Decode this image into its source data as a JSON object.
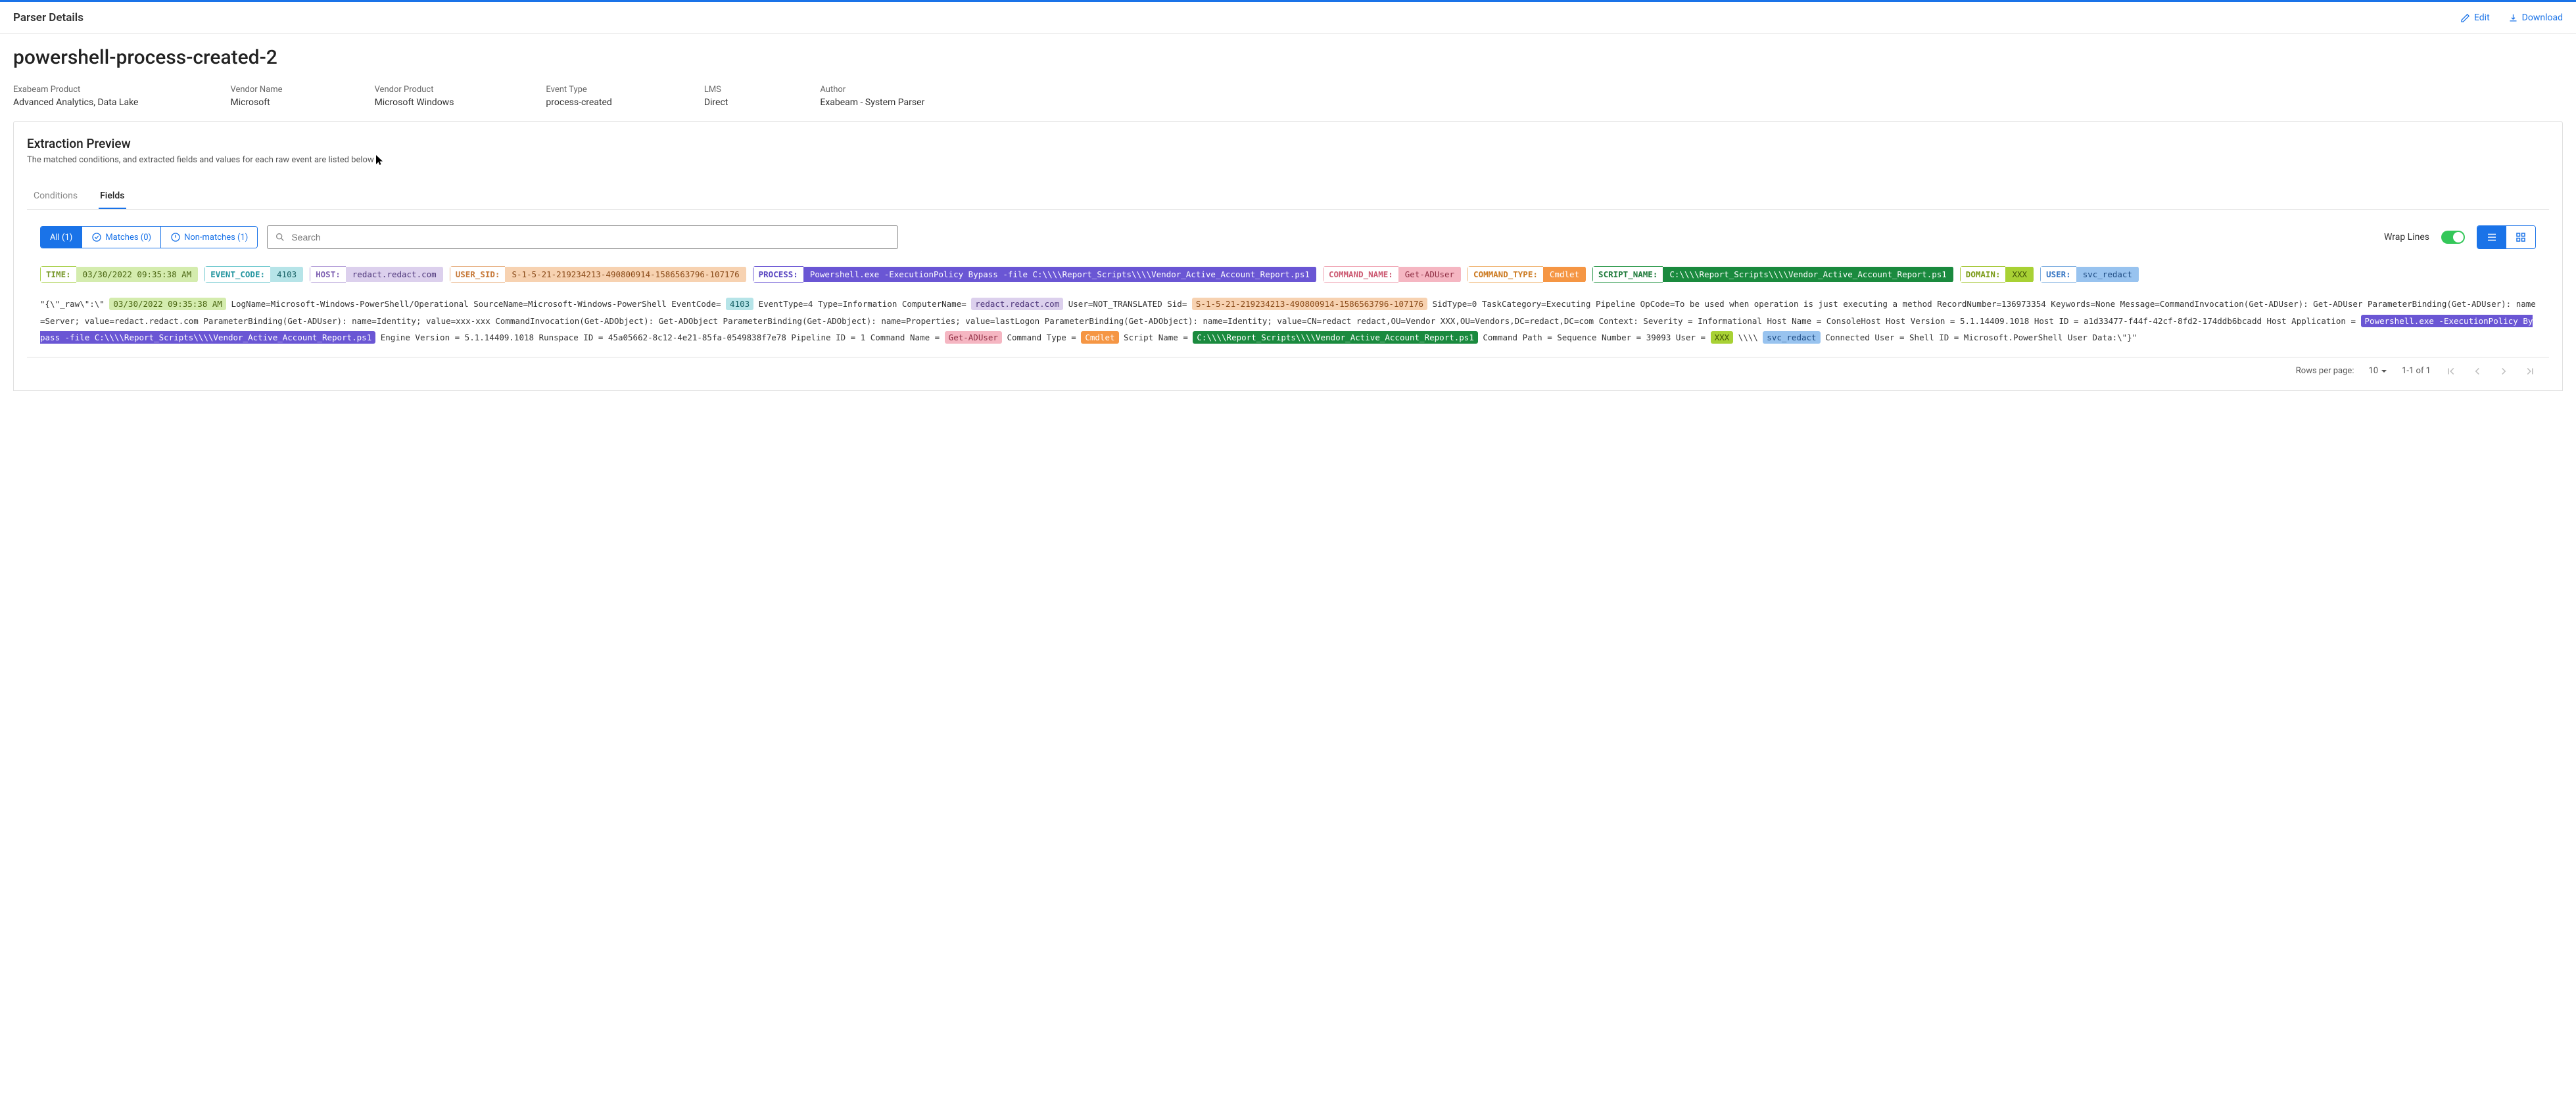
{
  "header": {
    "title": "Parser Details",
    "edit": "Edit",
    "download": "Download"
  },
  "parser_name": "powershell-process-created-2",
  "meta": {
    "product_label": "Exabeam Product",
    "product_value": "Advanced Analytics, Data Lake",
    "vendor_label": "Vendor Name",
    "vendor_value": "Microsoft",
    "vprod_label": "Vendor Product",
    "vprod_value": "Microsoft Windows",
    "etype_label": "Event Type",
    "etype_value": "process-created",
    "lms_label": "LMS",
    "lms_value": "Direct",
    "author_label": "Author",
    "author_value": "Exabeam - System Parser"
  },
  "preview": {
    "title": "Extraction Preview",
    "subtitle": "The matched conditions, and extracted fields and values for each raw event are listed below"
  },
  "tabs": {
    "conditions": "Conditions",
    "fields": "Fields"
  },
  "seg": {
    "all": "All (1)",
    "matches": "Matches (0)",
    "nonmatches": "Non-matches (1)"
  },
  "search_placeholder": "Search",
  "wrap": "Wrap Lines",
  "pills": {
    "time_k": "TIME:",
    "time_v": "03/30/2022 09:35:38 AM",
    "ec_k": "EVENT_CODE:",
    "ec_v": "4103",
    "host_k": "HOST:",
    "host_v": "redact.redact.com",
    "sid_k": "USER_SID:",
    "sid_v": "S-1-5-21-219234213-490800914-1586563796-107176",
    "proc_k": "PROCESS:",
    "proc_v": "Powershell.exe -ExecutionPolicy Bypass -file C:\\\\\\\\Report_Scripts\\\\\\\\Vendor_Active_Account_Report.ps1",
    "cmd_k": "COMMAND_NAME:",
    "cmd_v": "Get-ADUser",
    "ctype_k": "COMMAND_TYPE:",
    "ctype_v": "Cmdlet",
    "script_k": "SCRIPT_NAME:",
    "script_v": "C:\\\\\\\\Report_Scripts\\\\\\\\Vendor_Active_Account_Report.ps1",
    "dom_k": "DOMAIN:",
    "dom_v": "XXX",
    "user_k": "USER:",
    "user_v": "svc_redact"
  },
  "raw": {
    "p1a": "\"{\\\"_raw\\\":\\\" ",
    "time": "03/30/2022 09:35:38 AM",
    "p1b": " LogName=Microsoft-Windows-PowerShell/Operational SourceName=Microsoft-Windows-PowerShell EventCode= ",
    "ec": "4103",
    "p1c": " EventType=4 Type=Information ComputerName= ",
    "host": "redact.redact.com",
    "p1d": " User=NOT_TRANSLATED Sid= ",
    "sid": "S-1-5-21-219234213-490800914-1586563796-107176",
    "p2a": " SidType=0 TaskCategory=Executing Pipeline OpCode=To be used when operation is just executing a method RecordNumber=136973354 Keywords=None Message=CommandInvocation(Get-ADUser): Get-ADUser ParameterBinding(Get-ADUser): name=Server; value=redact.redact.com ParameterBinding(Get-ADUser): name=Identity; value=xxx-xxx CommandInvocation(Get-ADObject): Get-ADObject ParameterBinding(Get-ADObject): name=Properties; value=lastLogon ParameterBinding(Get-ADObject): name=Identity; value=CN=redact redact,OU=Vendor XXX,OU=Vendors,DC=redact,DC=com Context: Severity = Informational Host Name = ConsoleHost Host Version = 5.1.14409.1018 Host ID = a1d33477-f44f-42cf-8fd2-174ddb6bcadd Host Application = ",
    "proc": "Powershell.exe -ExecutionPolicy Bypass -file C:\\\\\\\\Report_Scripts\\\\\\\\Vendor_Active_Account_Report.ps1",
    "p3a": " Engine Version = 5.1.14409.1018 Runspace ID = 45a05662-8c12-4e21-85fa-0549838f7e78 Pipeline ID = 1 Command Name = ",
    "cmd": "Get-ADUser",
    "p3b": " Command Type = ",
    "ctype": "Cmdlet",
    "p3c": " Script Name = ",
    "script": "C:\\\\\\\\Report_Scripts\\\\\\\\Vendor_Active_Account_Report.ps1",
    "p4a": " Command Path = Sequence Number = 39093 User = ",
    "dom": "XXX",
    "p4b": " \\\\\\\\ ",
    "user": "svc_redact",
    "p4c": " Connected User = Shell ID = Microsoft.PowerShell User Data:\\\"}\""
  },
  "pager": {
    "rows_label": "Rows per page:",
    "rows_value": "10",
    "range": "1-1 of 1"
  }
}
